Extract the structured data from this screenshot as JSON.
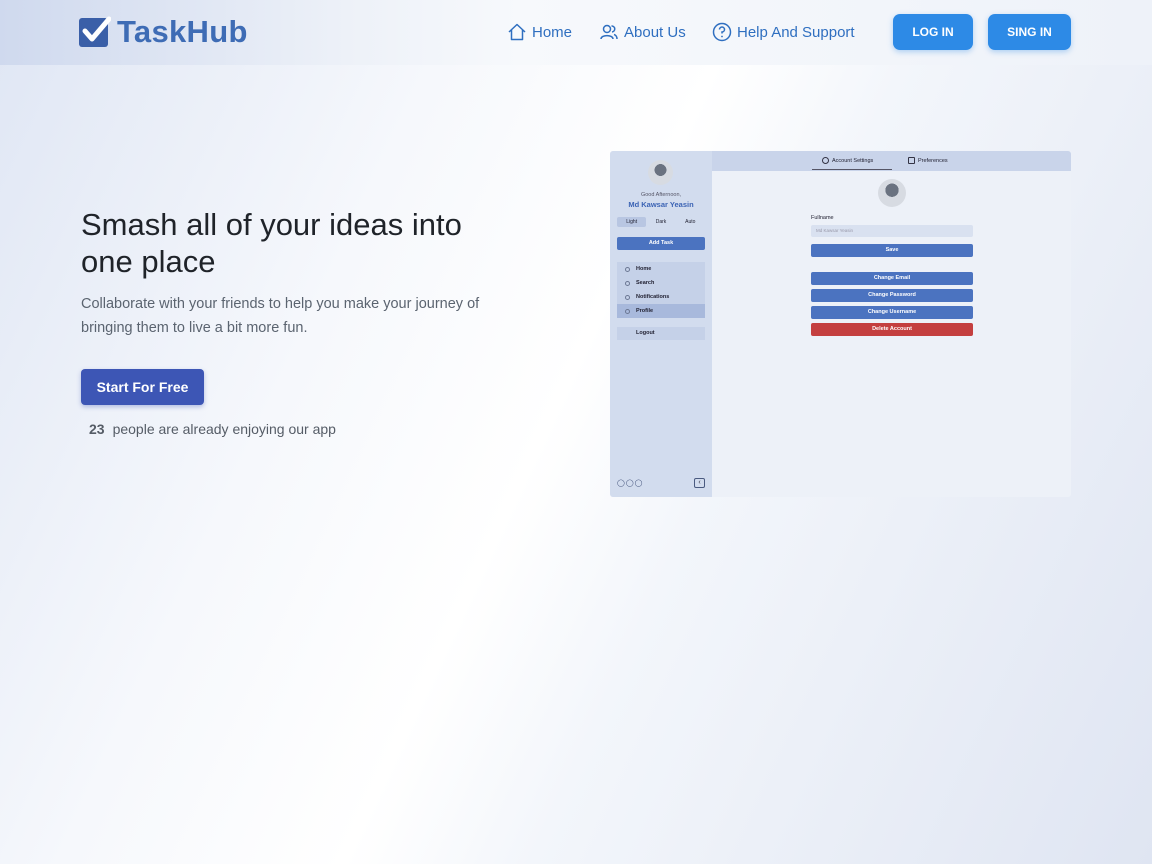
{
  "brand": {
    "name": "TaskHub"
  },
  "nav": {
    "home": "Home",
    "about": "About Us",
    "help": "Help And Support",
    "login": "LOG IN",
    "signin": "SING IN"
  },
  "hero": {
    "title": "Smash all of your ideas into one place",
    "subtitle": "Collaborate with your friends to help you make your journey of bringing them to live a bit more fun.",
    "cta": "Start For Free",
    "user_count": "23",
    "user_text": "people are already enjoying our app"
  },
  "preview": {
    "tabs": {
      "account": "Account Settings",
      "preferences": "Preferences"
    },
    "greeting": "Good Afternoon,",
    "user_name": "Md Kawsar Yeasin",
    "theme": {
      "light": "Light",
      "dark": "Dark",
      "auto": "Auto"
    },
    "add_task": "Add Task",
    "menu": [
      "Home",
      "Search",
      "Notifications",
      "Profile"
    ],
    "logout": "Logout",
    "fullname_label": "Fullname",
    "fullname_placeholder": "Md Kawsar Yeasin",
    "save": "Save",
    "change_email": "Change Email",
    "change_password": "Change Password",
    "change_username": "Change Username",
    "delete_account": "Delete Account"
  },
  "colors": {
    "brand": "#3e6cb5",
    "nav_link": "#2f6fc0",
    "top_button": "#2d8ae6",
    "cta": "#3d56b5",
    "danger": "#c43f3f"
  }
}
